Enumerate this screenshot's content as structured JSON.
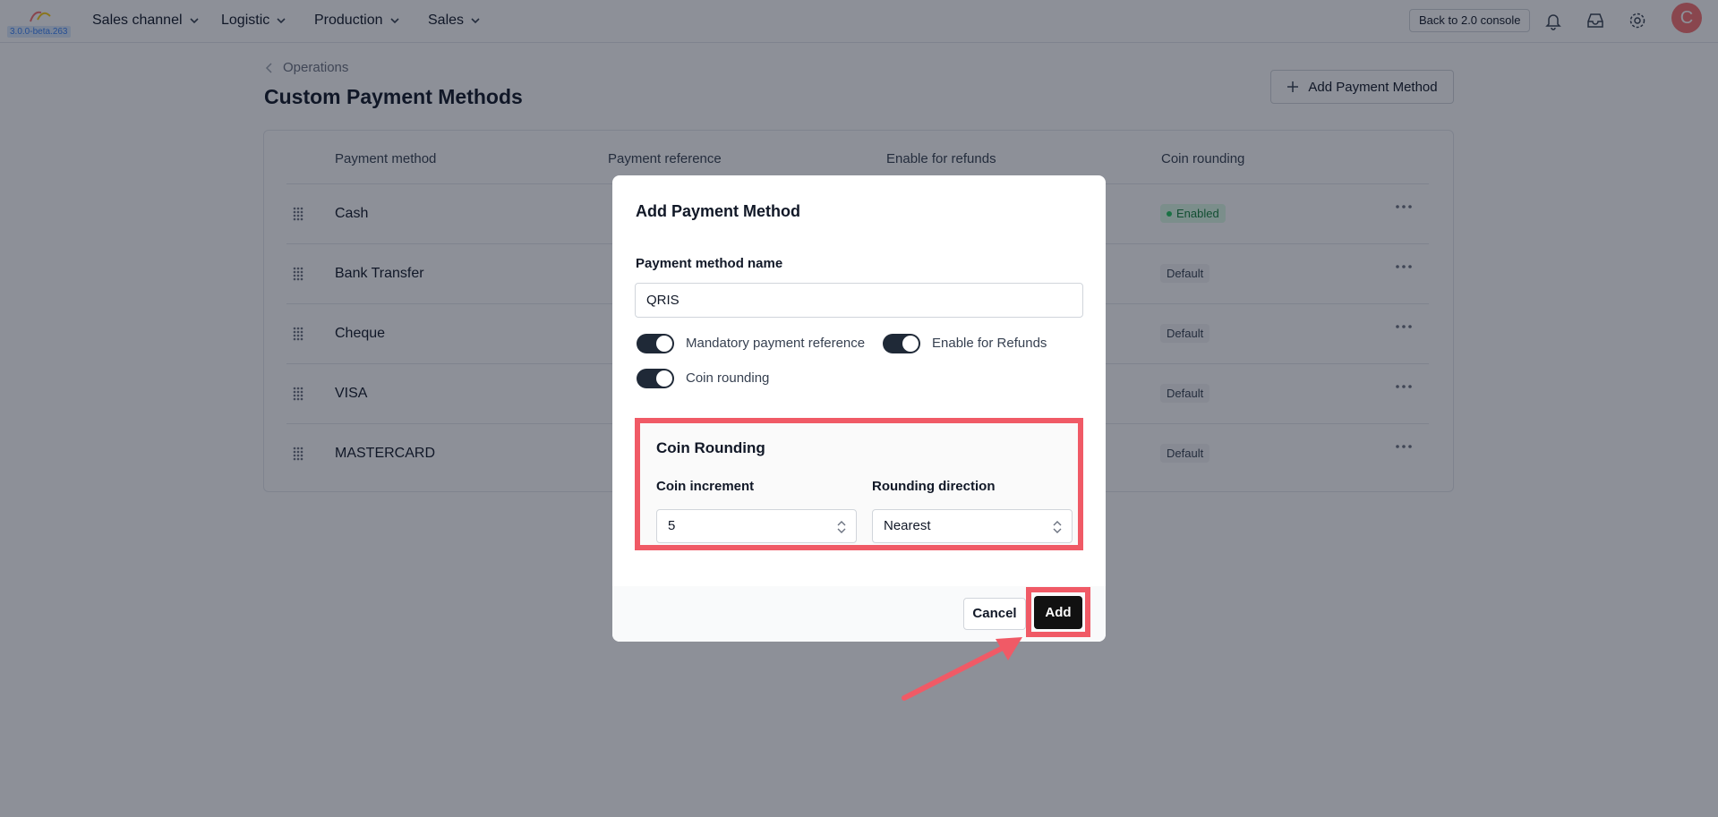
{
  "app": {
    "version": "3.0.0-beta.263",
    "nav": [
      {
        "label": "Sales channel"
      },
      {
        "label": "Logistic"
      },
      {
        "label": "Production"
      },
      {
        "label": "Sales"
      }
    ],
    "back_button": "Back to 2.0 console",
    "avatar_initial": "C"
  },
  "page": {
    "breadcrumb": "Operations",
    "title": "Custom Payment Methods",
    "add_button": "Add Payment Method",
    "columns": [
      "Payment method",
      "Payment reference",
      "Enable for refunds",
      "Coin rounding"
    ],
    "rows": [
      {
        "name": "Cash",
        "coin_rounding": "Enabled"
      },
      {
        "name": "Bank Transfer",
        "coin_rounding": "Default"
      },
      {
        "name": "Cheque",
        "coin_rounding": "Default"
      },
      {
        "name": "VISA",
        "coin_rounding": "Default"
      },
      {
        "name": "MASTERCARD",
        "coin_rounding": "Default"
      }
    ]
  },
  "modal": {
    "title": "Add Payment Method",
    "name_label": "Payment method name",
    "name_value": "QRIS",
    "toggles": {
      "mandatory_reference": {
        "label": "Mandatory payment reference",
        "on": true
      },
      "enable_refunds": {
        "label": "Enable for Refunds",
        "on": true
      },
      "coin_rounding": {
        "label": "Coin rounding",
        "on": true
      }
    },
    "rounding": {
      "title": "Coin Rounding",
      "increment_label": "Coin increment",
      "increment_value": "5",
      "direction_label": "Rounding direction",
      "direction_value": "Nearest"
    },
    "cancel_label": "Cancel",
    "add_label": "Add"
  },
  "colors": {
    "highlight": "#f05a66",
    "primary_button": "#111111",
    "enabled_green": "#22c55e",
    "avatar": "#f87171"
  },
  "icons": [
    "logo-icon",
    "chevron-down-icon",
    "bell-icon",
    "inbox-icon",
    "gear-icon",
    "chevron-left-icon",
    "plus-icon",
    "drag-handle-icon",
    "more-icon",
    "select-arrows-icon"
  ]
}
